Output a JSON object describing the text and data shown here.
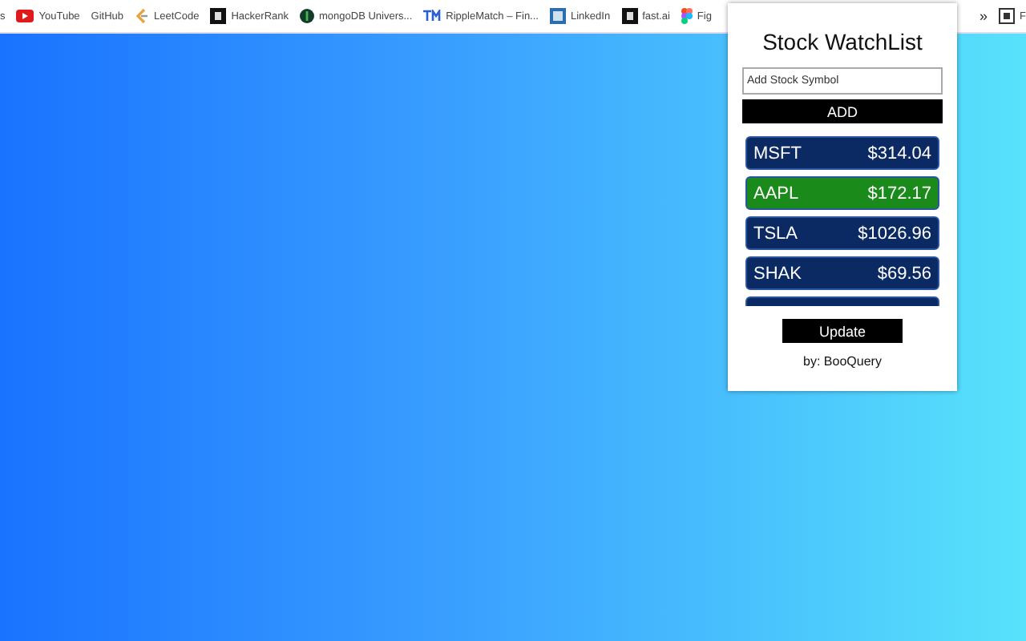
{
  "bookmarks": [
    {
      "label": "s",
      "kind": "none"
    },
    {
      "label": "YouTube",
      "kind": "video"
    },
    {
      "label": "GitHub",
      "kind": "none"
    },
    {
      "label": "LeetCode",
      "kind": "code"
    },
    {
      "label": "HackerRank",
      "kind": "dark"
    },
    {
      "label": "mongoDB Univers...",
      "kind": "leaf"
    },
    {
      "label": "RippleMatch – Fin...",
      "kind": "tm"
    },
    {
      "label": "LinkedIn",
      "kind": "tile"
    },
    {
      "label": "fast.ai",
      "kind": "dark"
    },
    {
      "label": "Fig",
      "kind": "shapes"
    }
  ],
  "overflow": {
    "label": "»"
  },
  "far_bookmark": {
    "label": "F"
  },
  "popup": {
    "title": "Stock WatchList",
    "input": {
      "placeholder": "Add Stock Symbol"
    },
    "add_button": "ADD",
    "stocks": [
      {
        "symbol": "MSFT",
        "price": "$314.04",
        "color": "#0b2a63"
      },
      {
        "symbol": "AAPL",
        "price": "$172.17",
        "color": "#1a8a1a"
      },
      {
        "symbol": "TSLA",
        "price": "$1026.96",
        "color": "#0b2a63"
      },
      {
        "symbol": "SHAK",
        "price": "$69.56",
        "color": "#0b2a63"
      },
      {
        "color": "#0b2a63"
      }
    ],
    "update_button": "Update",
    "credit": "by: BooQuery"
  }
}
